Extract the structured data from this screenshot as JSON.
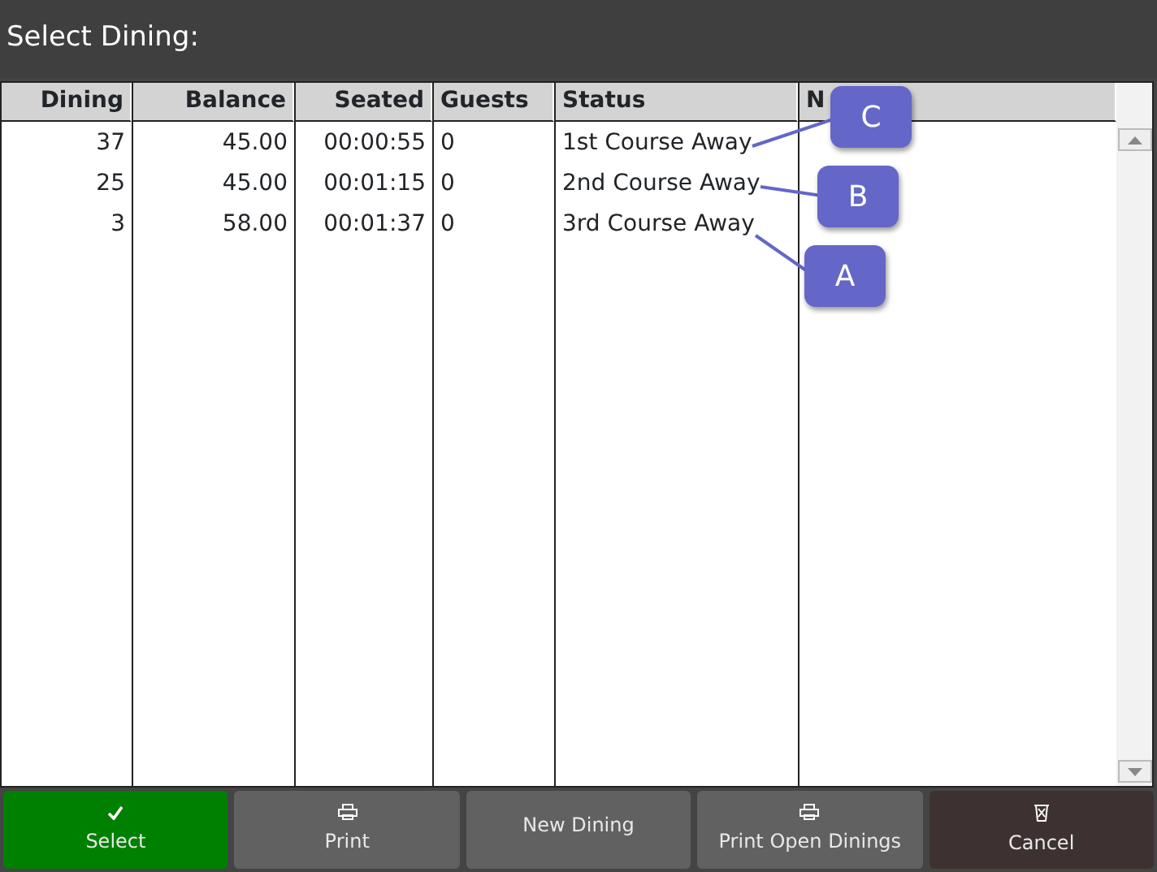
{
  "window": {
    "title": "Select Dining:"
  },
  "table": {
    "columns": [
      "Dining",
      "Balance",
      "Seated",
      "Guests",
      "Status",
      "N"
    ],
    "rows": [
      {
        "cells": [
          "37",
          "45.00",
          "00:00:55",
          "0",
          "1st Course Away"
        ]
      },
      {
        "cells": [
          "25",
          "45.00",
          "00:01:15",
          "0",
          "2nd Course Away"
        ]
      },
      {
        "cells": [
          "3",
          "58.00",
          "00:01:37",
          "0",
          "3rd Course Away"
        ]
      }
    ]
  },
  "callouts": [
    {
      "label": "C"
    },
    {
      "label": "B"
    },
    {
      "label": "A"
    }
  ],
  "buttons": [
    {
      "label": "Select",
      "kind": "check"
    },
    {
      "label": "Print",
      "kind": "print"
    },
    {
      "label": "New Dining",
      "kind": "plain"
    },
    {
      "label": "Print Open Dinings",
      "kind": "print"
    },
    {
      "label": "Cancel",
      "kind": "trash"
    }
  ]
}
